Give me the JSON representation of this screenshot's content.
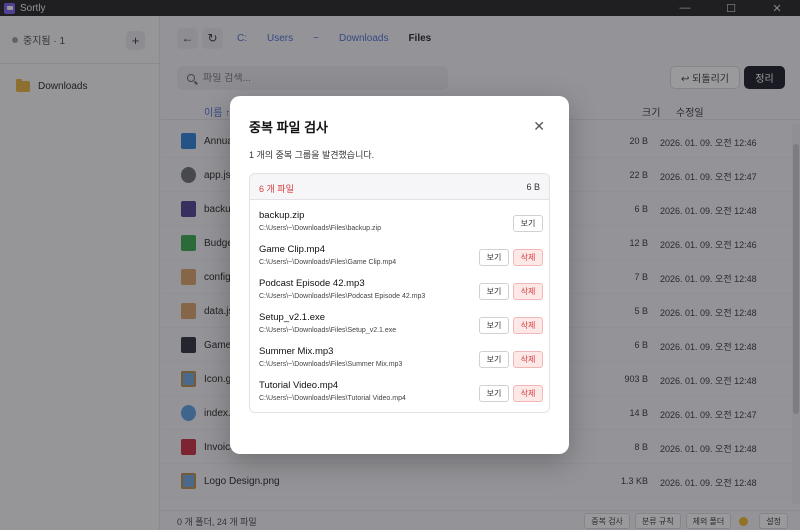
{
  "app": {
    "title": "Sortly"
  },
  "window_controls": {
    "minimize": "—",
    "maximize": "☐",
    "close": "✕"
  },
  "sidebar": {
    "status": "중지됨 · 1",
    "add_label": "+",
    "items": [
      {
        "label": "Downloads"
      }
    ]
  },
  "toolbar": {
    "back_label": "←",
    "refresh_label": "↻",
    "breadcrumb": [
      "C:",
      "Users",
      "~",
      "Downloads",
      "Files"
    ],
    "search_placeholder": "파일 검색...",
    "undo_label": "↩ 되돌리기",
    "organize_label": "정리"
  },
  "table": {
    "headers": {
      "name": "이름 ↑",
      "size": "크기",
      "modified": "수정일"
    },
    "rows": [
      {
        "name": "Annual_Report.pdf",
        "size": "20 B",
        "modified": "2026. 01. 09. 오전 12:46",
        "icon": "book-blue-icon"
      },
      {
        "name": "app.js",
        "size": "22 B",
        "modified": "2026. 01. 09. 오전 12:47",
        "icon": "gear-icon"
      },
      {
        "name": "backup.zip",
        "size": "6 B",
        "modified": "2026. 01. 09. 오전 12:48",
        "icon": "clamp-icon"
      },
      {
        "name": "Budget_2024.xlsx",
        "size": "12 B",
        "modified": "2026. 01. 09. 오전 12:46",
        "icon": "book-green-icon"
      },
      {
        "name": "config.json",
        "size": "7 B",
        "modified": "2026. 01. 09. 오전 12:48",
        "icon": "clipboard-icon"
      },
      {
        "name": "data.json",
        "size": "5 B",
        "modified": "2026. 01. 09. 오전 12:48",
        "icon": "clipboard-icon"
      },
      {
        "name": "Game Clip.mp4",
        "size": "6 B",
        "modified": "2026. 01. 09. 오전 12:48",
        "icon": "clapper-icon"
      },
      {
        "name": "Icon.gif",
        "size": "903 B",
        "modified": "2026. 01. 09. 오전 12:48",
        "icon": "picture-icon"
      },
      {
        "name": "index.html",
        "size": "14 B",
        "modified": "2026. 01. 09. 오전 12:47",
        "icon": "globe-icon"
      },
      {
        "name": "Invoice_March.pdf",
        "size": "8 B",
        "modified": "2026. 01. 09. 오전 12:48",
        "icon": "book-red-icon"
      },
      {
        "name": "Logo Design.png",
        "size": "1.3 KB",
        "modified": "2026. 01. 09. 오전 12:48",
        "icon": "picture-icon"
      }
    ]
  },
  "status_bar": {
    "summary": "0 개 폴더, 24 개 파일",
    "buttons": [
      "중복 검사",
      "분류 규칙",
      "제외 폴더"
    ],
    "settings_label": "설정"
  },
  "dialog": {
    "title": "중복 파일 검사",
    "close_label": "✕",
    "message": "1 개의 중복 그룹을 발견했습니다.",
    "group": {
      "count_label": "6 개 파일",
      "size_label": "6 B",
      "files": [
        {
          "name": "backup.zip",
          "path": "C:\\Users\\~\\Downloads\\Files\\backup.zip",
          "view": "보기",
          "delete": ""
        },
        {
          "name": "Game Clip.mp4",
          "path": "C:\\Users\\~\\Downloads\\Files\\Game Clip.mp4",
          "view": "보기",
          "delete": "삭제"
        },
        {
          "name": "Podcast Episode 42.mp3",
          "path": "C:\\Users\\~\\Downloads\\Files\\Podcast Episode 42.mp3",
          "view": "보기",
          "delete": "삭제"
        },
        {
          "name": "Setup_v2.1.exe",
          "path": "C:\\Users\\~\\Downloads\\Files\\Setup_v2.1.exe",
          "view": "보기",
          "delete": "삭제"
        },
        {
          "name": "Summer Mix.mp3",
          "path": "C:\\Users\\~\\Downloads\\Files\\Summer Mix.mp3",
          "view": "보기",
          "delete": "삭제"
        },
        {
          "name": "Tutorial Video.mp4",
          "path": "C:\\Users\\~\\Downloads\\Files\\Tutorial Video.mp4",
          "view": "보기",
          "delete": "삭제"
        }
      ]
    }
  },
  "colors": {
    "accent": "#4a6ad0",
    "danger": "#d63a3a",
    "primary_button": "#14161f",
    "folder": "#e8b33a"
  }
}
